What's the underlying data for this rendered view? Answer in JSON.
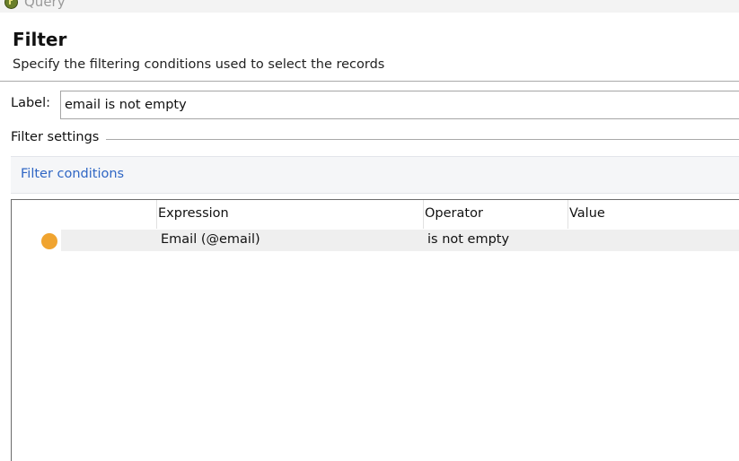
{
  "window": {
    "title": "Query",
    "icon": "app-logo-icon"
  },
  "header": {
    "title": "Filter",
    "subtitle": "Specify the filtering conditions used to select the records"
  },
  "label_field": {
    "label": "Label:",
    "value": "email is not empty"
  },
  "filter_settings": {
    "group_title": "Filter settings",
    "conditions_link": "Filter conditions"
  },
  "grid": {
    "columns": [
      "Expression",
      "Operator",
      "Value"
    ],
    "rows": [
      {
        "status_color": "#f0a430",
        "status_icon": "status-dot-icon",
        "expression": "Email (@email)",
        "operator": "is not empty",
        "value": ""
      }
    ]
  },
  "colors": {
    "link": "#2f66c4",
    "status_dot": "#f0a430",
    "row_highlight": "#efefef"
  }
}
